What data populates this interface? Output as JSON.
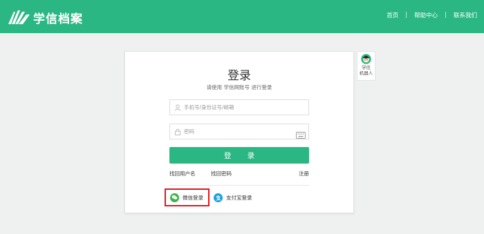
{
  "header": {
    "logo_text": "学信档案",
    "nav": [
      "首页",
      "帮助中心",
      "联系我们"
    ],
    "nav_separator": "|",
    "bg_color": "#2ab784"
  },
  "login": {
    "title": "登录",
    "subtitle": "请使用 学信网账号 进行登录",
    "username_placeholder": "手机号/身份证号/邮箱",
    "password_placeholder": "密码",
    "submit_label": "登 录",
    "find_username": "找回用户名",
    "find_password": "找回密码",
    "register": "注册",
    "wechat_login": "微信登录",
    "alipay_login": "支付宝登录"
  },
  "robot": {
    "label_line1": "学信",
    "label_line2": "机器人"
  },
  "colors": {
    "accent": "#2ab784",
    "wechat": "#3bb34a",
    "alipay": "#1aa0e0",
    "highlight_border": "#e0151b"
  },
  "icons": {
    "user": "user-icon",
    "lock": "lock-icon",
    "keyboard": "keyboard-icon",
    "wechat": "wechat-icon",
    "alipay": "alipay-icon",
    "logo": "book-logo-icon",
    "robot": "robot-avatar-icon"
  }
}
